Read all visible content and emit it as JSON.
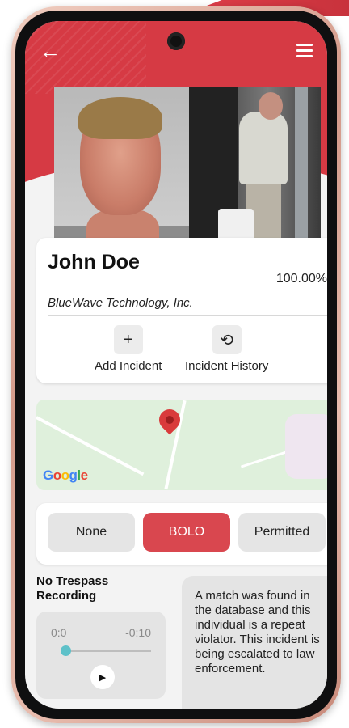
{
  "header": {
    "back_icon": "arrow-left-icon",
    "menu_icon": "hamburger-menu-icon",
    "colors": {
      "primary": "#d63a44",
      "background": "#f3f3f3"
    }
  },
  "profile": {
    "name": "John Doe",
    "match_score": "100.00%",
    "company": "BlueWave Technology, Inc.",
    "actions": [
      {
        "label": "Add Incident",
        "icon": "plus-icon",
        "glyph": "+"
      },
      {
        "label": "Incident History",
        "icon": "history-icon",
        "glyph": "⟲"
      }
    ]
  },
  "map": {
    "logo_letters": [
      "G",
      "o",
      "o",
      "g",
      "l",
      "e"
    ]
  },
  "status": {
    "options": [
      "None",
      "BOLO",
      "Permitted"
    ],
    "selected": "BOLO",
    "selected_color": "#d9474f"
  },
  "recording": {
    "title": "No Trespass Recording",
    "time_current": "0:0",
    "time_remaining": "-0:10"
  },
  "message": {
    "text": "A match was found in the database and this individual is a repeat violator. This incident is being escalated to law enforcement."
  }
}
